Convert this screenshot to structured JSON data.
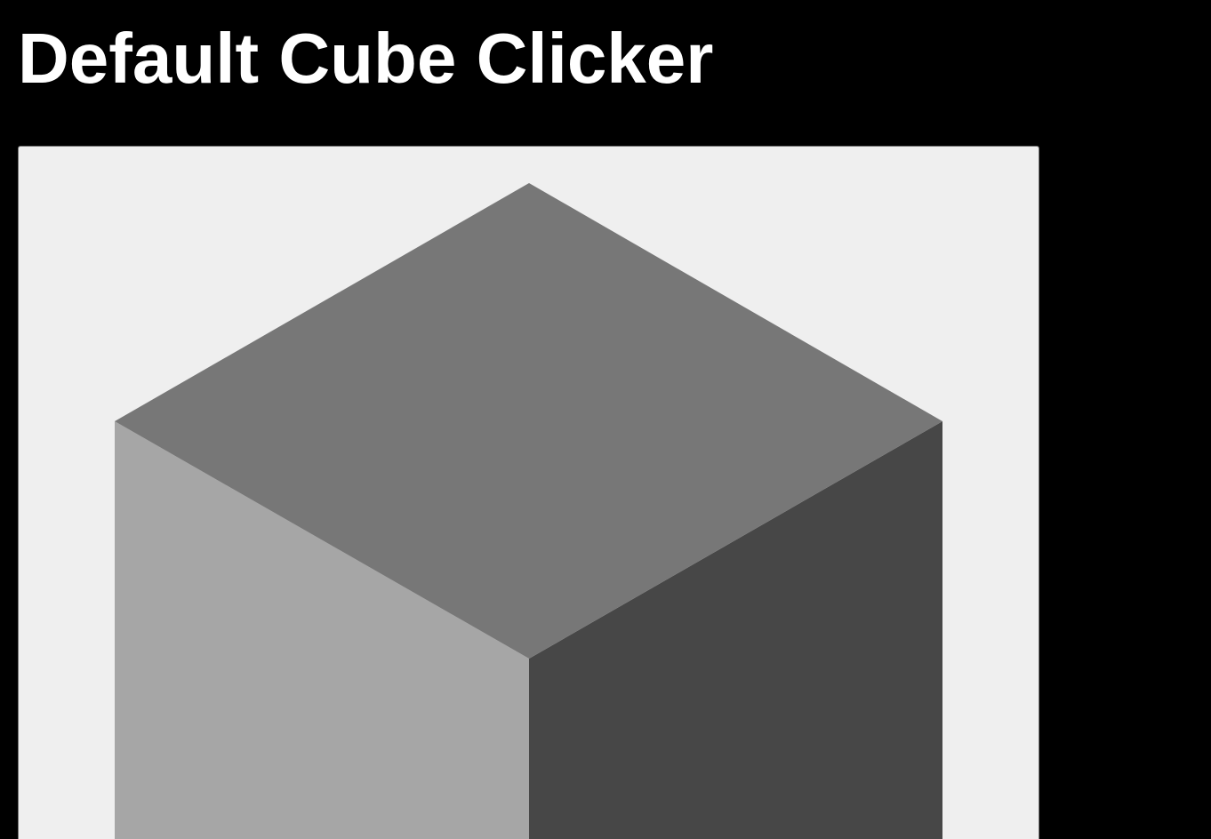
{
  "header": {
    "title": "Default Cube Clicker"
  },
  "cube": {
    "icon": "cube-icon",
    "colors": {
      "background": "#efefef",
      "top_face": "#777777",
      "left_face": "#a6a6a6",
      "right_face": "#474747"
    }
  },
  "colors": {
    "page_background": "#000000",
    "title_text": "#ffffff"
  }
}
